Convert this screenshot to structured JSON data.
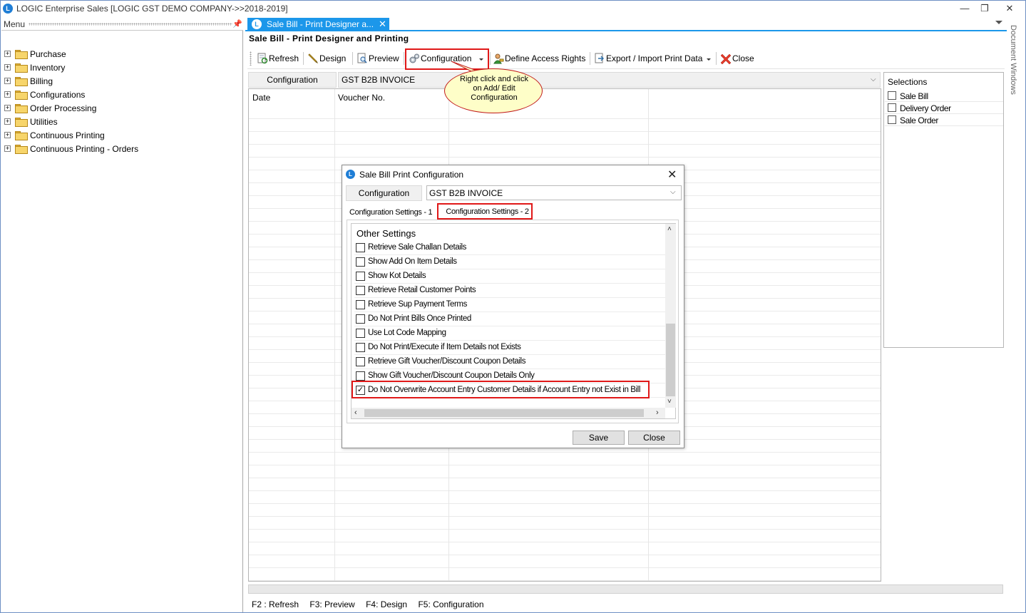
{
  "app": {
    "title": "LOGIC Enterprise Sales  [LOGIC GST DEMO COMPANY->>2018-2019]",
    "logo": "L",
    "minimize": "—",
    "restore": "❐",
    "close": "✕"
  },
  "menu": {
    "label": "Menu",
    "pin": "📌",
    "items": [
      {
        "label": "Purchase"
      },
      {
        "label": "Inventory"
      },
      {
        "label": "Billing"
      },
      {
        "label": "Configurations"
      },
      {
        "label": "Order Processing"
      },
      {
        "label": "Utilities"
      },
      {
        "label": "Continuous Printing"
      },
      {
        "label": "Continuous Printing - Orders"
      }
    ]
  },
  "doc_tab": {
    "label": "Sale Bill - Print Designer a...",
    "close": "✕"
  },
  "page": {
    "title": "Sale Bill - Print Designer and Printing"
  },
  "toolbar": {
    "refresh": "Refresh",
    "design": "Design",
    "preview": "Preview",
    "configuration": "Configuration",
    "define_access_rights": "Define Access Rights",
    "export_import": "Export / Import Print Data",
    "close": "Close"
  },
  "callout": {
    "text": "Right click and click on Add/ Edit Configuration"
  },
  "config_bar": {
    "label": "Configuration",
    "value": "GST B2B INVOICE",
    "chevron": "⌄"
  },
  "grid": {
    "columns": [
      "Date",
      "Voucher No."
    ]
  },
  "selections": {
    "title": "Selections",
    "items": [
      "Sale Bill",
      "Delivery Order",
      "Sale Order"
    ]
  },
  "side": {
    "document_windows": "Document Windows"
  },
  "statusbar": {
    "items": [
      "F2 : Refresh",
      "F3:  Preview",
      "F4: Design",
      "F5: Configuration"
    ]
  },
  "dialog": {
    "title": "Sale Bill Print Configuration",
    "close": "✕",
    "config_label": "Configuration",
    "config_value": "GST B2B INVOICE",
    "chevron": "⌄",
    "tabs": [
      "Configuration Settings - 1",
      "Configuration Settings - 2"
    ],
    "section_title": "Other Settings",
    "settings": [
      {
        "label": "Retrieve Sale Challan Details",
        "checked": false
      },
      {
        "label": "Show Add On Item Details",
        "checked": false
      },
      {
        "label": "Show Kot Details",
        "checked": false
      },
      {
        "label": "Retrieve Retail Customer Points",
        "checked": false
      },
      {
        "label": "Retrieve Sup Payment Terms",
        "checked": false
      },
      {
        "label": "Do Not Print Bills Once Printed",
        "checked": false
      },
      {
        "label": "Use Lot Code Mapping",
        "checked": false
      },
      {
        "label": "Do Not Print/Execute if Item Details not Exists",
        "checked": false
      },
      {
        "label": "Retrieve Gift Voucher/Discount Coupon Details",
        "checked": false
      },
      {
        "label": "Show Gift Voucher/Discount Coupon Details Only",
        "checked": false
      },
      {
        "label": "Do Not Overwrite Account Entry Customer Details if Account Entry not Exist in Bill",
        "checked": true
      }
    ],
    "save": "Save",
    "close_button": "Close"
  },
  "colors": {
    "accent": "#1c97ea",
    "highlight": "#e01818",
    "callout_fill": "#fefec8"
  }
}
